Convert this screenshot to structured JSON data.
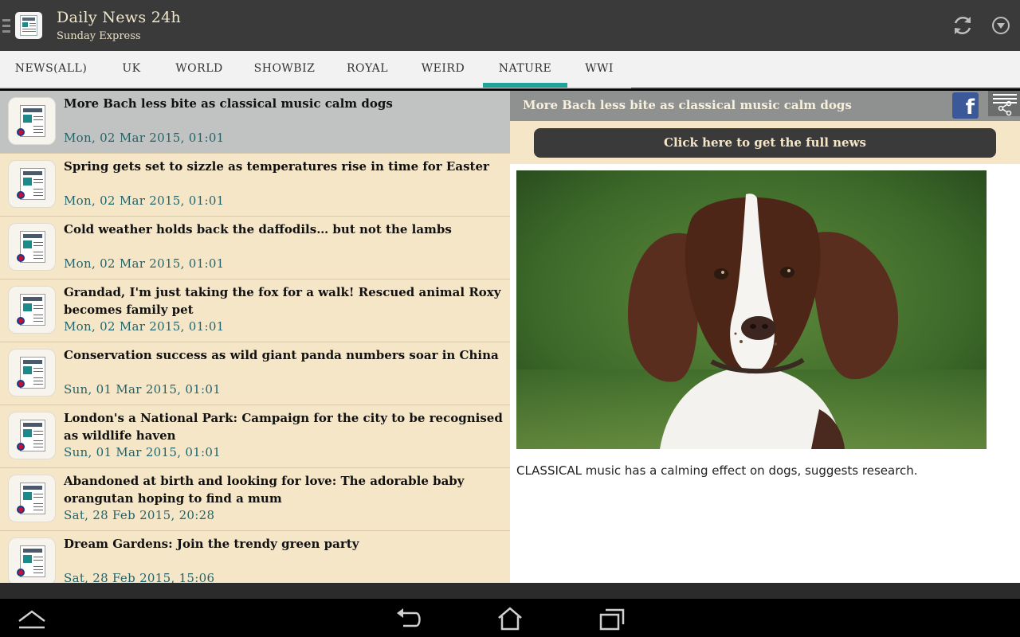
{
  "app": {
    "title": "Daily News 24h",
    "subtitle": "Sunday Express"
  },
  "actions": {
    "refresh_icon": "refresh-icon",
    "overflow_icon": "dropdown-circle-icon"
  },
  "tabs": [
    {
      "label": "NEWS(ALL)",
      "active": false
    },
    {
      "label": "UK",
      "active": false
    },
    {
      "label": "WORLD",
      "active": false
    },
    {
      "label": "SHOWBIZ",
      "active": false
    },
    {
      "label": "ROYAL",
      "active": false
    },
    {
      "label": "WEIRD",
      "active": false
    },
    {
      "label": "NATURE",
      "active": true
    },
    {
      "label": "WWI",
      "active": false
    }
  ],
  "news": [
    {
      "title": "More Bach less bite as classical music calm dogs",
      "date": "Mon, 02 Mar 2015, 01:01",
      "selected": true
    },
    {
      "title": "Spring gets set to sizzle as temperatures rise in time for Easter",
      "date": "Mon, 02 Mar 2015, 01:01",
      "selected": false
    },
    {
      "title": "Cold weather holds back the daffodils… but not the lambs",
      "date": "Mon, 02 Mar 2015, 01:01",
      "selected": false
    },
    {
      "title": "Grandad, I'm just taking the fox for a walk! Rescued animal Roxy becomes family pet",
      "date": "Mon, 02 Mar 2015, 01:01",
      "selected": false
    },
    {
      "title": "Conservation success as wild giant panda numbers soar in China",
      "date": "Sun, 01 Mar 2015, 01:01",
      "selected": false
    },
    {
      "title": "London's a National Park: Campaign for the city to be recognised as wildlife haven",
      "date": "Sun, 01 Mar 2015, 01:01",
      "selected": false
    },
    {
      "title": "Abandoned at birth and looking for love: The adorable baby orangutan hoping to find a mum",
      "date": "Sat, 28 Feb 2015, 20:28",
      "selected": false
    },
    {
      "title": "Dream Gardens: Join the trendy green party",
      "date": "Sat, 28 Feb 2015, 15:06",
      "selected": false
    }
  ],
  "detail": {
    "title": "More Bach less bite as classical music calm dogs",
    "full_news_label": "Click here to get the full news",
    "summary": "CLASSICAL music has a calming effect on dogs, suggests research.",
    "facebook_glyph": "f"
  },
  "colors": {
    "actionbar": "#3a3a3a",
    "accent": "#1fa39a",
    "list_bg": "#f6e6c8",
    "selected_row": "#c0c3c2",
    "date_text": "#22636a"
  }
}
